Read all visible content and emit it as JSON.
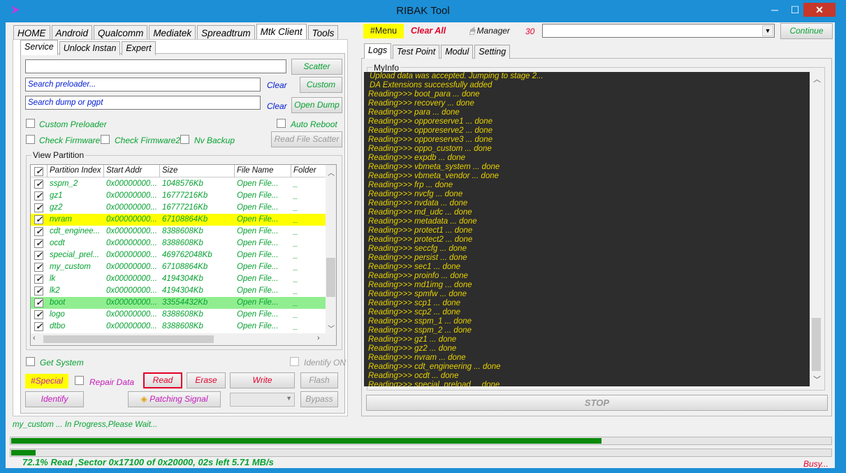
{
  "window": {
    "title": "RIBAK Tool"
  },
  "main_tabs": [
    "HOME",
    "Android",
    "Qualcomm",
    "Mediatek",
    "Spreadtrum",
    "Mtk Client",
    "Tools"
  ],
  "active_main_tab": "Mtk Client",
  "sub_tabs": [
    "Service",
    "Unlock Instan",
    "Expert"
  ],
  "toolbar": {
    "menu": "#Menu",
    "clear_all": "Clear All",
    "manager": "Manager",
    "manager_count": "30",
    "continue": "Continue"
  },
  "service": {
    "scatter_btn": "Scatter",
    "preloader_placeholder": "Search preloader...",
    "clear1": "Clear",
    "custom_btn": "Custom",
    "dump_placeholder": "Search dump or pgpt",
    "clear2": "Clear",
    "open_dump_btn": "Open Dump",
    "custom_preloader": "Custom Preloader",
    "auto_reboot": "Auto Reboot",
    "check_firmware": "Check Firmware",
    "check_firmware2": "Check Firmware2",
    "nv_backup": "Nv Backup",
    "read_file_scatter": "Read File Scatter",
    "view_partition": "View Partition",
    "get_system": "Get System",
    "identify_on": "Identify ON",
    "special": "#Special",
    "repair_data": "Repair Data",
    "read": "Read",
    "erase": "Erase",
    "write": "Write",
    "flash": "Flash",
    "identify": "Identify",
    "patching_signal": "Patching Signal",
    "bypass": "Bypass"
  },
  "grid": {
    "headers": [
      "Partition Index",
      "Start Addr",
      "Size",
      "File Name",
      "Folder"
    ],
    "rows": [
      {
        "name": "sspm_2",
        "addr": "0x00000000...",
        "size": "1048576Kb",
        "file": "Open File...",
        "folder": "_"
      },
      {
        "name": "gz1",
        "addr": "0x00000000...",
        "size": "16777216Kb",
        "file": "Open File...",
        "folder": "_"
      },
      {
        "name": "gz2",
        "addr": "0x00000000...",
        "size": "16777216Kb",
        "file": "Open File...",
        "folder": "_"
      },
      {
        "name": "nvram",
        "addr": "0x00000000...",
        "size": "67108864Kb",
        "file": "Open File...",
        "folder": "_"
      },
      {
        "name": "cdt_enginee...",
        "addr": "0x00000000...",
        "size": "8388608Kb",
        "file": "Open File...",
        "folder": "_"
      },
      {
        "name": "ocdt",
        "addr": "0x00000000...",
        "size": "8388608Kb",
        "file": "Open File...",
        "folder": "_"
      },
      {
        "name": "special_prel...",
        "addr": "0x00000000...",
        "size": "469762048Kb",
        "file": "Open File...",
        "folder": "_"
      },
      {
        "name": "my_custom",
        "addr": "0x00000000...",
        "size": "67108864Kb",
        "file": "Open File...",
        "folder": "_"
      },
      {
        "name": "lk",
        "addr": "0x00000000...",
        "size": "4194304Kb",
        "file": "Open File...",
        "folder": "_"
      },
      {
        "name": "lk2",
        "addr": "0x00000000...",
        "size": "4194304Kb",
        "file": "Open File...",
        "folder": "_"
      },
      {
        "name": "boot",
        "addr": "0x00000000...",
        "size": "33554432Kb",
        "file": "Open File...",
        "folder": "_"
      },
      {
        "name": "logo",
        "addr": "0x00000000...",
        "size": "8388608Kb",
        "file": "Open File...",
        "folder": "_"
      },
      {
        "name": "dtbo",
        "addr": "0x00000000...",
        "size": "8388608Kb",
        "file": "Open File...",
        "folder": "_"
      }
    ]
  },
  "right_tabs": [
    "Logs",
    "Test Point",
    "Modul",
    "Setting"
  ],
  "myinfo_label": "MyInfo",
  "log_lines": [
    "Upload data was accepted. Jumping to stage 2...",
    "DA Extensions successfully added",
    "Reading>>> boot_para ...  done",
    "Reading>>> recovery ...  done",
    "Reading>>> para ...  done",
    "Reading>>> opporeserve1 ...  done",
    "Reading>>> opporeserve2 ...  done",
    "Reading>>> opporeserve3 ...  done",
    "Reading>>> oppo_custom ...  done",
    "Reading>>> expdb ...  done",
    "Reading>>> vbmeta_system ...  done",
    "Reading>>> vbmeta_vendor ...  done",
    "Reading>>> frp ...  done",
    "Reading>>> nvcfg ...  done",
    "Reading>>> nvdata ...  done",
    "Reading>>> md_udc ...  done",
    "Reading>>> metadata ...  done",
    "Reading>>> protect1 ...  done",
    "Reading>>> protect2 ...  done",
    "Reading>>> seccfg ...  done",
    "Reading>>> persist ...  done",
    "Reading>>> sec1 ...  done",
    "Reading>>> proinfo ...  done",
    "Reading>>> md1img ...  done",
    "Reading>>> spmfw ...  done",
    "Reading>>> scp1 ...  done",
    "Reading>>> scp2 ...  done",
    "Reading>>> sspm_1 ...  done",
    "Reading>>> sspm_2 ...  done",
    "Reading>>> gz1 ...  done",
    "Reading>>> gz2 ...  done",
    "Reading>>> nvram ...  done",
    "Reading>>> cdt_engineering ...  done",
    "Reading>>> ocdt ...  done",
    "Reading>>> special_preload ...  done"
  ],
  "stop_btn": "STOP",
  "status": {
    "progress_text": "my_custom ... In Progress,Please Wait...",
    "progress1": 0.72,
    "progress2": 0.03,
    "read_info": "72.1% Read ,Sector 0x17100 of 0x20000, 02s left 5.71 MB/s",
    "busy": "Busy..."
  }
}
